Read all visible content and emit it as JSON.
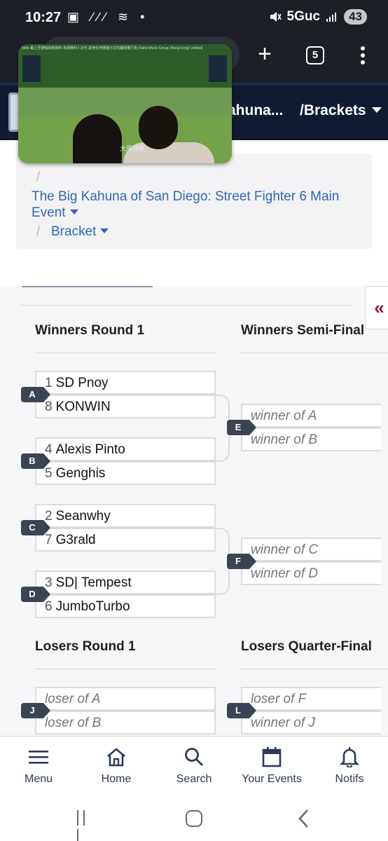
{
  "status_bar": {
    "time": "10:27",
    "left_icons": "▣ ∕∕∕ ≋ •",
    "network": "5Guc",
    "battery": "43"
  },
  "browser": {
    "tab_count": "5"
  },
  "site_nav": {
    "crumb_event": "ahuna...",
    "crumb_brackets": "/Brackets"
  },
  "breadcrumb": {
    "separator": "/",
    "event_title": "The Big Kahuna of San Diego: Street Fighter 6 Main Event",
    "bracket_label": "Bracket"
  },
  "video": {
    "caption": "大風得獸",
    "ticker": "Taihe 載上至德唱歌榜資料 未經權利人許可 其他任何傳播方式均屬侵權行為 [Taihe Music Group (Hong Kong) Limited]"
  },
  "bracket": {
    "collapse_icon": "«",
    "rounds": [
      {
        "title": "Winners Round 1"
      },
      {
        "title": "Winners Semi-Final"
      },
      {
        "title": "Losers Round 1"
      },
      {
        "title": "Losers Quarter-Final"
      }
    ],
    "sets": [
      {
        "id": "A",
        "top": {
          "seed": "1",
          "name": "SD Pnoy"
        },
        "bottom": {
          "seed": "8",
          "name": "KONWIN"
        }
      },
      {
        "id": "B",
        "top": {
          "seed": "4",
          "name": "Alexis Pinto"
        },
        "bottom": {
          "seed": "5",
          "name": "Genghis"
        }
      },
      {
        "id": "C",
        "top": {
          "seed": "2",
          "name": "Seanwhy"
        },
        "bottom": {
          "seed": "7",
          "name": "G3rald"
        }
      },
      {
        "id": "D",
        "top": {
          "seed": "3",
          "name": "SD| Tempest"
        },
        "bottom": {
          "seed": "6",
          "name": "JumboTurbo"
        }
      },
      {
        "id": "E",
        "top": {
          "name": "winner of A"
        },
        "bottom": {
          "name": "winner of B"
        }
      },
      {
        "id": "F",
        "top": {
          "name": "winner of C"
        },
        "bottom": {
          "name": "winner of D"
        }
      },
      {
        "id": "J",
        "top": {
          "name": "loser of A"
        },
        "bottom": {
          "name": "loser of B"
        }
      },
      {
        "id": "L",
        "top": {
          "name": "loser of F"
        },
        "bottom": {
          "name": "winner of J"
        }
      }
    ]
  },
  "bottom_nav": [
    {
      "label": "Menu",
      "icon": "menu-icon"
    },
    {
      "label": "Home",
      "icon": "home-icon"
    },
    {
      "label": "Search",
      "icon": "search-icon"
    },
    {
      "label": "Your Events",
      "icon": "calendar-icon"
    },
    {
      "label": "Notifs",
      "icon": "bell-icon"
    }
  ]
}
